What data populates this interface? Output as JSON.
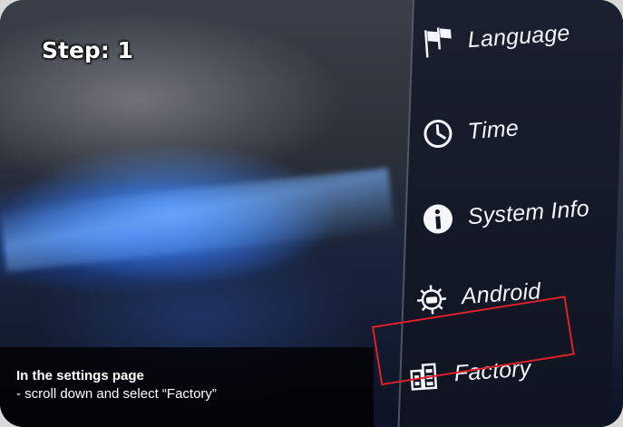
{
  "step": {
    "label": "Step: 1"
  },
  "menu": {
    "items": [
      {
        "label": "Language",
        "icon": "flags-icon"
      },
      {
        "label": "Time",
        "icon": "clock-icon"
      },
      {
        "label": "System Info",
        "icon": "info-icon"
      },
      {
        "label": "Android",
        "icon": "android-gear-icon"
      },
      {
        "label": "Factory",
        "icon": "factory-icon"
      }
    ],
    "selected": "Factory"
  },
  "caption": {
    "title": "In the settings page",
    "subtitle": "- scroll down and select “Factory”"
  },
  "colors": {
    "highlight": "#e0202a",
    "text": "#f4f6fb",
    "caption_bg": "#000000"
  }
}
